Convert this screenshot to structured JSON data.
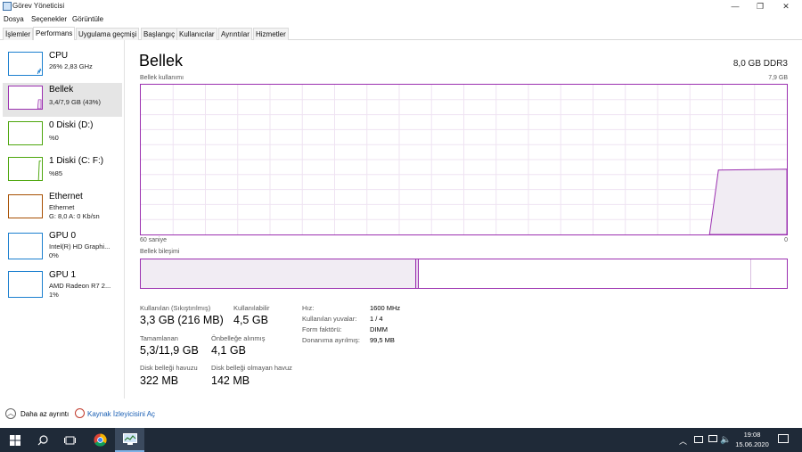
{
  "window": {
    "title": "Görev Yöneticisi",
    "min_glyph": "—",
    "max_glyph": "❐",
    "close_glyph": "✕"
  },
  "menu": [
    "Dosya",
    "Seçenekler",
    "Görüntüle"
  ],
  "tabs": [
    "İşlemler",
    "Performans",
    "Uygulama geçmişi",
    "Başlangıç",
    "Kullanıcılar",
    "Ayrıntılar",
    "Hizmetler"
  ],
  "active_tab": "Performans",
  "sidebar": {
    "items": [
      {
        "name": "CPU",
        "sub1": "26% 2,83 GHz",
        "sub2": "",
        "color": "#1b7fcf"
      },
      {
        "name": "Bellek",
        "sub1": "3,4/7,9 GB (43%)",
        "sub2": "",
        "color": "#9b30b0"
      },
      {
        "name": "0 Diski (D:)",
        "sub1": "%0",
        "sub2": "",
        "color": "#4da60c"
      },
      {
        "name": "1 Diski (C: F:)",
        "sub1": "%85",
        "sub2": "",
        "color": "#4da60c"
      },
      {
        "name": "Ethernet",
        "sub1": "Ethernet",
        "sub2": "G: 8,0 A: 0 Kb/sn",
        "color": "#a74f01"
      },
      {
        "name": "GPU 0",
        "sub1": "Intel(R) HD Graphi...",
        "sub2": "0%",
        "color": "#1b7fcf"
      },
      {
        "name": "GPU 1",
        "sub1": "AMD Radeon R7 2...",
        "sub2": "1%",
        "color": "#1b7fcf"
      }
    ]
  },
  "main": {
    "title": "Bellek",
    "memory_type": "8,0 GB DDR3",
    "usage_label": "Bellek kullanımı",
    "usage_max": "7,9 GB",
    "axis_left": "60 saniye",
    "axis_right": "0",
    "composition_label": "Bellek bileşimi",
    "usage_fraction": 0.43
  },
  "stats": {
    "in_use_label": "Kullanılan (Sıkıştırılmış)",
    "in_use_value": "3,3 GB (216 MB)",
    "available_label": "Kullanılabilir",
    "available_value": "4,5 GB",
    "committed_label": "Tamamlanan",
    "committed_value": "5,3/11,9 GB",
    "cached_label": "Önbelleğe alınmış",
    "cached_value": "4,1 GB",
    "paged_label": "Disk belleği havuzu",
    "paged_value": "322 MB",
    "nonpaged_label": "Disk belleği olmayan havuz",
    "nonpaged_value": "142 MB"
  },
  "details": [
    {
      "label": "Hız:",
      "value": "1600 MHz"
    },
    {
      "label": "Kullanılan yuvalar:",
      "value": "1 / 4"
    },
    {
      "label": "Form faktörü:",
      "value": "DIMM"
    },
    {
      "label": "Donanıma ayrılmış:",
      "value": "99,5 MB"
    }
  ],
  "footer": {
    "fewer_details": "Daha az ayrıntı",
    "resource_monitor": "Kaynak İzleyicisini Aç"
  },
  "taskbar": {
    "time": "19:08",
    "date": "15.06.2020"
  }
}
